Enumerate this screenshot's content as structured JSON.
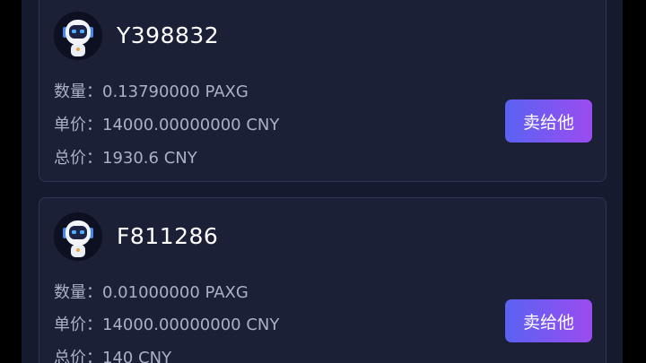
{
  "colors": {
    "page_bg": "#161a2e",
    "card_bg": "#1b2037",
    "card_border": "#2f3552",
    "text_primary": "#ffffff",
    "text_secondary": "#aab0c8",
    "button_gradient_start": "#5a62f2",
    "button_gradient_end": "#9b4cf0"
  },
  "offers": [
    {
      "avatar_icon": "astronaut-avatar-icon",
      "user": "Y398832",
      "quantity_line": "数量：0.13790000 PAXG",
      "price_line": "单价：14000.00000000 CNY",
      "total_line": "总价：1930.6 CNY",
      "sell_label": "卖给他"
    },
    {
      "avatar_icon": "astronaut-avatar-icon",
      "user": "F811286",
      "quantity_line": "数量：0.01000000 PAXG",
      "price_line": "单价：14000.00000000 CNY",
      "total_line": "总价：140 CNY",
      "sell_label": "卖给他"
    }
  ]
}
